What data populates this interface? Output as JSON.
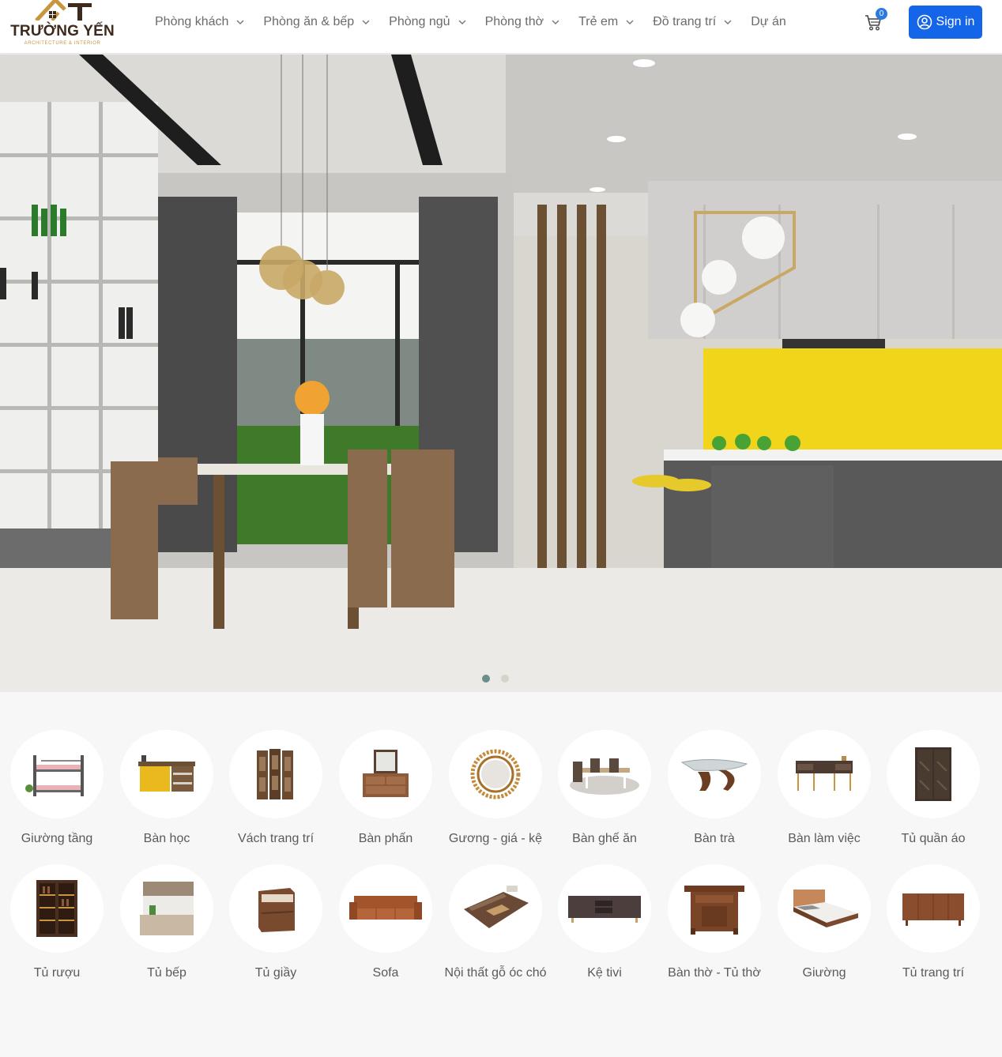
{
  "brand": {
    "name": "TRƯỜNG YẾN",
    "tagline": "ARCHITECTURE & INTERIOR",
    "gold": "#c8963e",
    "dark": "#3d2a1c"
  },
  "nav": {
    "items": [
      {
        "label": "Phòng khách",
        "has_dropdown": true
      },
      {
        "label": "Phòng ăn & bếp",
        "has_dropdown": true
      },
      {
        "label": "Phòng ngủ",
        "has_dropdown": true
      },
      {
        "label": "Phòng thờ",
        "has_dropdown": true
      },
      {
        "label": "Trẻ em",
        "has_dropdown": true
      },
      {
        "label": "Đồ trang trí",
        "has_dropdown": true
      },
      {
        "label": "Dự án",
        "has_dropdown": false
      }
    ]
  },
  "cart": {
    "count": "0",
    "icon": "cart-icon"
  },
  "signin": {
    "label": "Sign in",
    "icon": "user-circle-icon",
    "color": "#1565e8"
  },
  "hero": {
    "slides": 2,
    "active_slide": 1
  },
  "categories": {
    "row1": [
      {
        "label": "Giường tầng",
        "icon": "bunk-bed"
      },
      {
        "label": "Bàn học",
        "icon": "study-desk"
      },
      {
        "label": "Vách trang trí",
        "icon": "room-divider"
      },
      {
        "label": "Bàn phấn",
        "icon": "dressing-table"
      },
      {
        "label": "Gương - giá - kệ",
        "icon": "round-mirror"
      },
      {
        "label": "Bàn ghế ăn",
        "icon": "dining-set"
      },
      {
        "label": "Bàn trà",
        "icon": "coffee-table"
      },
      {
        "label": "Bàn làm việc",
        "icon": "work-desk"
      },
      {
        "label": "Tủ quần áo",
        "icon": "wardrobe"
      }
    ],
    "row2": [
      {
        "label": "Tủ rượu",
        "icon": "wine-cabinet"
      },
      {
        "label": "Tủ bếp",
        "icon": "kitchen-cabinet"
      },
      {
        "label": "Tủ giầy",
        "icon": "shoe-cabinet"
      },
      {
        "label": "Sofa",
        "icon": "sofa"
      },
      {
        "label": "Nội thất gỗ óc chó",
        "icon": "walnut-living-set"
      },
      {
        "label": "Kệ tivi",
        "icon": "tv-stand"
      },
      {
        "label": "Bàn thờ - Tủ thờ",
        "icon": "altar"
      },
      {
        "label": "Giường",
        "icon": "bed"
      },
      {
        "label": "Tủ trang trí",
        "icon": "sideboard"
      }
    ]
  }
}
